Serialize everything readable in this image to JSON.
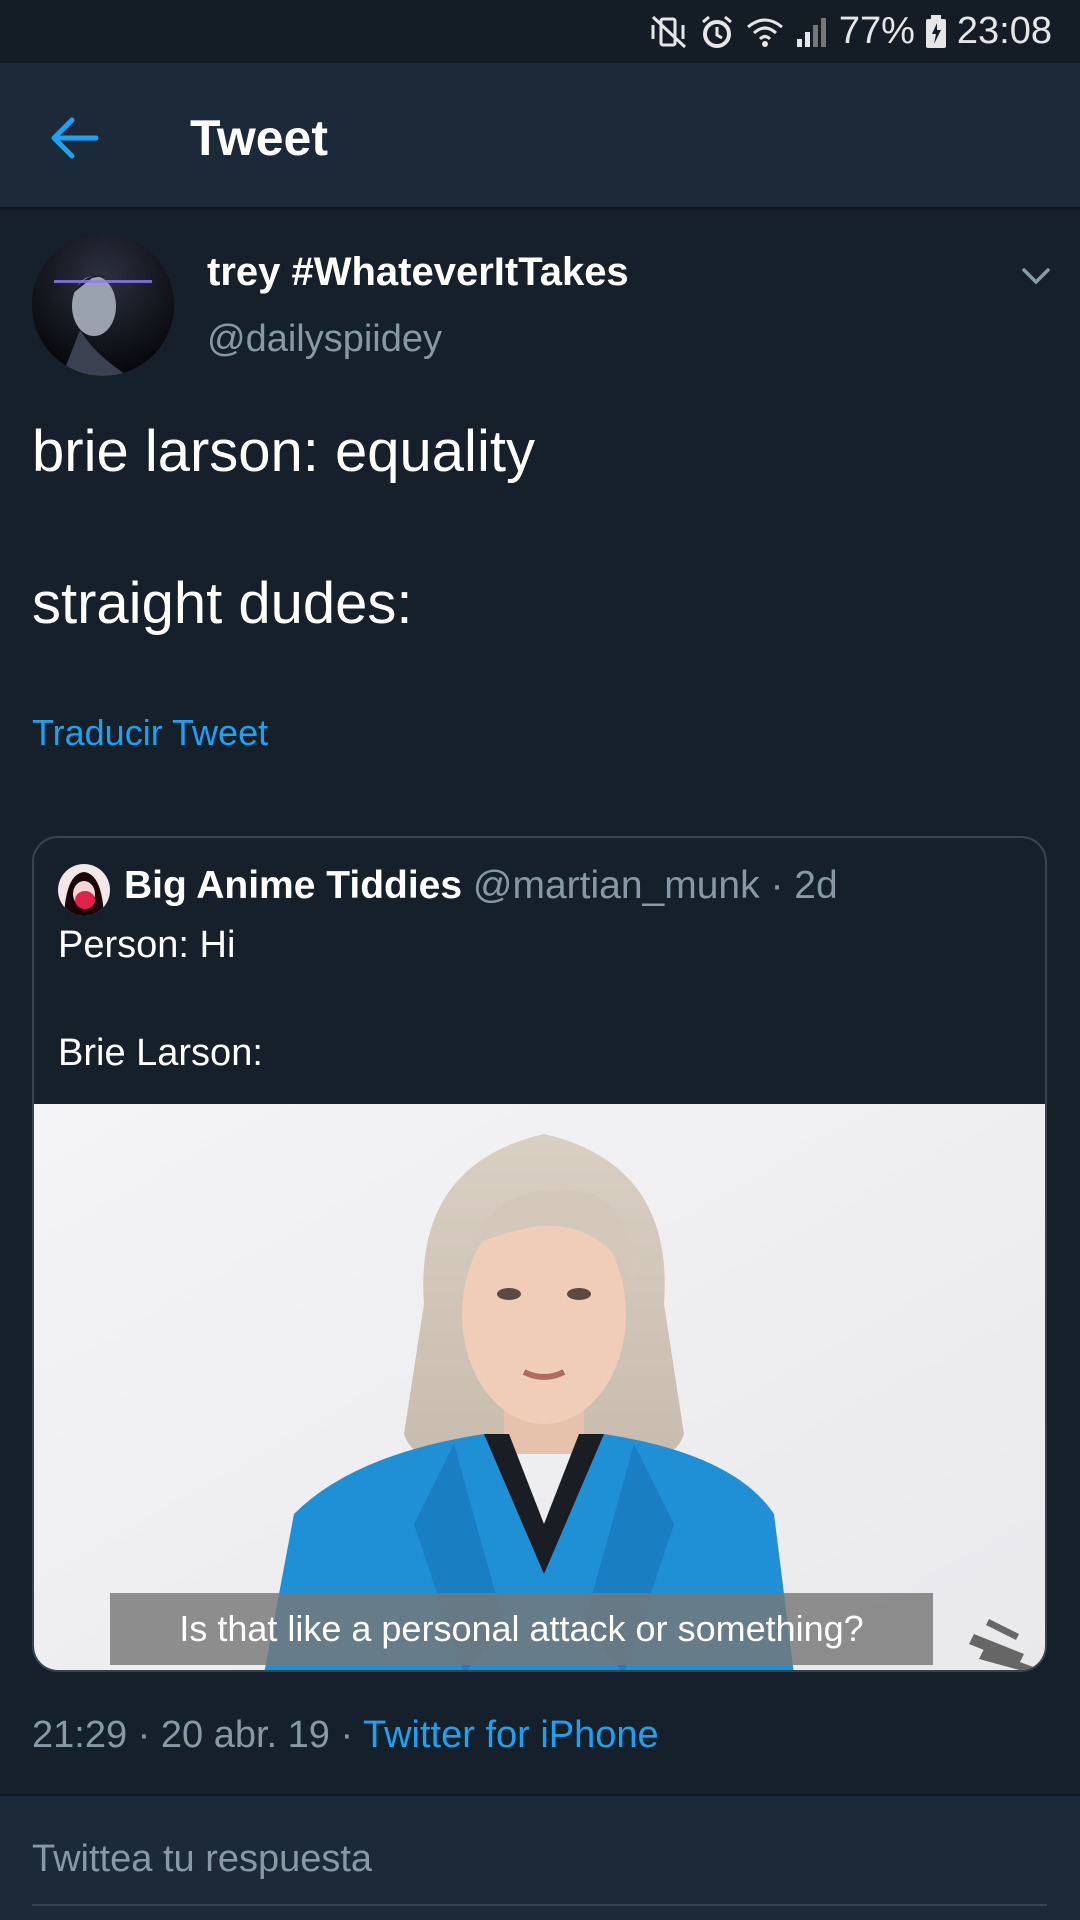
{
  "status_bar": {
    "icons": [
      "mute-vibrate-icon",
      "alarm-icon",
      "wifi-icon",
      "signal-icon",
      "battery-charging-icon"
    ],
    "battery": "77%",
    "time": "23:08"
  },
  "app_bar": {
    "title": "Tweet",
    "back_icon": "arrow-left-icon"
  },
  "tweet": {
    "author_name": "trey #WhateverItTakes",
    "author_handle": "@dailyspiidey",
    "text_line_1": "brie larson: equality",
    "text_line_2": "straight dudes:",
    "translate_label": "Traducir Tweet",
    "timestamp": "21:29 · 20 abr. 19 · ",
    "source": "Twitter for iPhone"
  },
  "quoted_tweet": {
    "author_name": "Big Anime Tiddies",
    "author_handle": "@martian_munk",
    "separator": " · ",
    "age": "2d",
    "text_line_1": "Person: Hi",
    "text_line_2": "Brie Larson:",
    "media_caption": "Is that like a personal attack or something?"
  },
  "reply": {
    "placeholder": "Twittea tu respuesta"
  },
  "colors": {
    "background": "#15202b",
    "app_bar": "#1c2938",
    "accent": "#1da1f2",
    "secondary_text": "#8899a6",
    "border": "#38444d"
  }
}
